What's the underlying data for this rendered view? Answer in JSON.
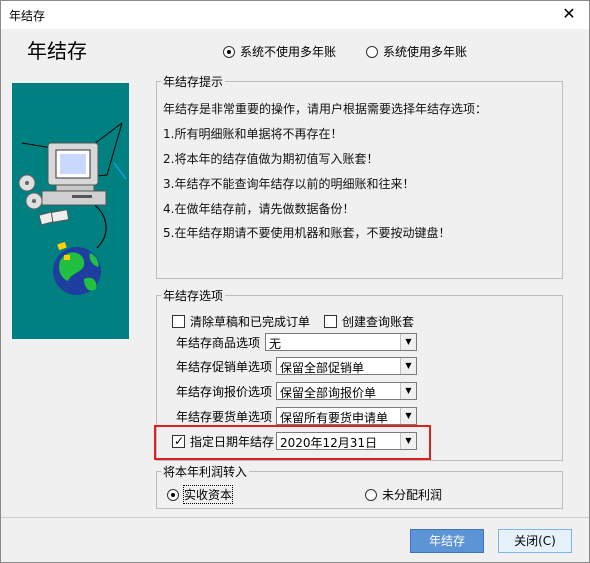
{
  "window": {
    "title": "年结存",
    "close_label": "✕"
  },
  "header": {
    "title": "年结存"
  },
  "mode": {
    "option_no_multiyear": "系统不使用多年账",
    "option_multiyear": "系统使用多年账",
    "selected": "option_no_multiyear"
  },
  "hints": {
    "legend": "年结存提示",
    "lines": [
      "年结存是非常重要的操作，请用户根据需要选择年结存选项：",
      "1.所有明细账和单据将不再存在！",
      "2.将本年的结存值做为期初值写入账套！",
      "3.年结存不能查询年结存以前的明细账和往来！",
      "4.在做年结存前，请先做数据备份！",
      "5.在年结存期请不要使用机器和账套，不要按动键盘！"
    ]
  },
  "options": {
    "legend": "年结存选项",
    "clear_drafts_label": "清除草稿和已完成订单",
    "clear_drafts_checked": false,
    "create_query_label": "创建查询账套",
    "create_query_checked": false,
    "product_label": "年结存商品选项",
    "product_value": "无",
    "promo_label": "年结存促销单选项",
    "promo_value": "保留全部促销单",
    "quote_label": "年结存询报价选项",
    "quote_value": "保留全部询报价单",
    "request_label": "年结存要货单选项",
    "request_value": "保留所有要货申请单",
    "date_label": "指定日期年结存",
    "date_checked": true,
    "date_value": "2020年12月31日"
  },
  "profit": {
    "legend": "将本年利润转入",
    "option_capital": "实收资本",
    "option_undistributed": "未分配利润",
    "selected": "option_capital"
  },
  "buttons": {
    "run_label": "年结存",
    "close_label": "关闭(C)"
  },
  "colors": {
    "illustration_bg": "#008080",
    "highlight_border": "#e02020",
    "primary_button": "#5c94d6"
  }
}
